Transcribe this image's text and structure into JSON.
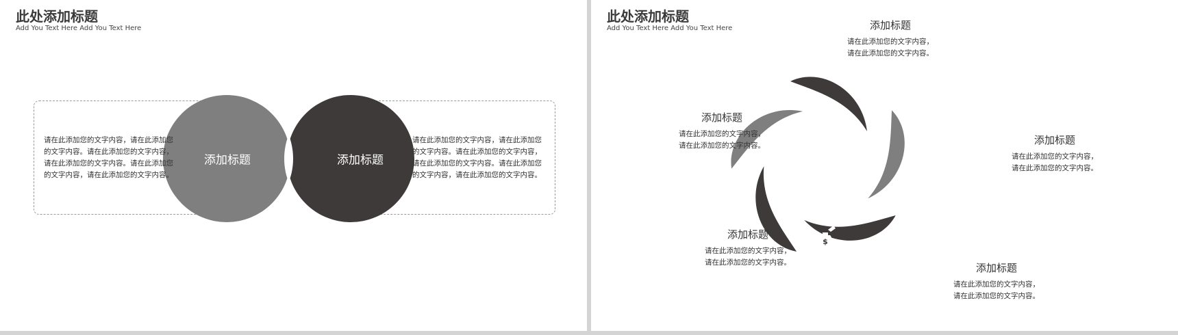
{
  "left_slide": {
    "title": "此处添加标题",
    "subtitle": "Add You Text Here Add You Text Here",
    "left_paragraph": [
      "请在此添加您的文字内容，请在此添加您",
      "的文字内容。请在此添加您的文字内容，",
      "请在此添加您的文字内容。请在此添加您",
      "的文字内容，请在此添加您的文字内容。"
    ],
    "right_paragraph": [
      "请在此添加您的文字内容，请在此添加您",
      "的文字内容。请在此添加您的文字内容，",
      "请在此添加您的文字内容。请在此添加您",
      "的文字内容，请在此添加您的文字内容。"
    ],
    "circle_left_label": "添加标题",
    "circle_right_label": "添加标题",
    "colors": {
      "left_circle": "#7f7f7f",
      "right_circle": "#3d3a39",
      "dash": "#9a9a9a"
    }
  },
  "right_slide": {
    "title": "此处添加标题",
    "subtitle": "Add You Text Here Add You Text Here",
    "items": [
      {
        "title": "添加标题",
        "line1": "请在此添加您的文字内容，",
        "line2": "请在此添加您的文字内容。",
        "icon": "growth-chart-team-icon"
      },
      {
        "title": "添加标题",
        "line1": "请在此添加您的文字内容，",
        "line2": "请在此添加您的文字内容。",
        "icon": "magnifier-person-icon"
      },
      {
        "title": "添加标题",
        "line1": "请在此添加您的文字内容，",
        "line2": "请在此添加您的文字内容。",
        "icon": "gears-team-icon"
      },
      {
        "title": "添加标题",
        "line1": "请在此添加您的文字内容，",
        "line2": "请在此添加您的文字内容。",
        "icon": "money-bag-hand-icon"
      },
      {
        "title": "添加标题",
        "line1": "请在此添加您的文字内容，",
        "line2": "请在此添加您的文字内容。",
        "icon": "lightbulb-hand-icon"
      }
    ],
    "colors": {
      "dark": "#3d3a39",
      "gray": "#7f7f7f"
    }
  }
}
